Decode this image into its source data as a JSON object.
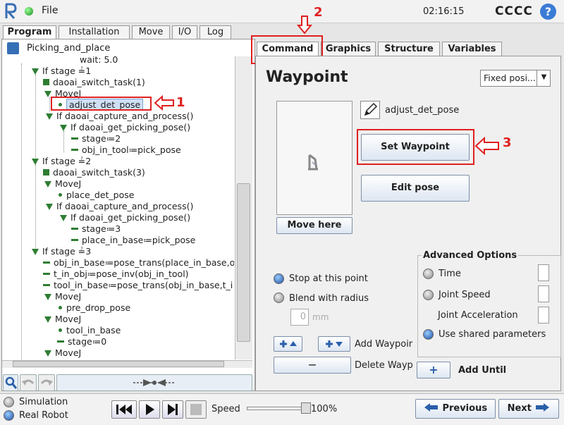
{
  "topbar": {
    "file_menu": "File",
    "clock": "02:16:15",
    "robot_name": "CCCC",
    "help": "?"
  },
  "main_tabs": [
    "Program",
    "Installation",
    "Move",
    "I/O",
    "Log"
  ],
  "program_name": "Picking_and_place",
  "tree": [
    "wait: 5.0",
    "If stage ≟1",
    "daoai_switch_task(1)",
    "MoveJ",
    "adjust_det_pose",
    "If daoai_capture_and_process()",
    "If daoai_get_picking_pose()",
    "stage≔2",
    "obj_in_tool≔pick_pose",
    "If stage ≟2",
    "daoai_switch_task(3)",
    "MoveJ",
    "place_det_pose",
    "If daoai_capture_and_process()",
    "If daoai_get_picking_pose()",
    "stage≔3",
    "place_in_base≔pick_pose",
    "If stage ≟3",
    "obj_in_base≔pose_trans(place_in_base,o",
    "t_in_obj≔pose_inv(obj_in_tool)",
    "tool_in_base≔pose_trans(obj_in_base,t_i",
    "MoveJ",
    "pre_drop_pose",
    "MoveJ",
    "tool_in_base",
    "stage≔0",
    "MoveJ"
  ],
  "right_tabs": [
    "Command",
    "Graphics",
    "Structure",
    "Variables"
  ],
  "waypoint": {
    "title": "Waypoint",
    "mode": "Fixed posi...",
    "name": "adjust_det_pose",
    "set_waypoint": "Set Waypoint",
    "edit_pose": "Edit pose",
    "move_here": "Move here",
    "stop_at_point": "Stop at this point",
    "blend_radius": "Blend with radius",
    "blend_value": "0",
    "blend_unit": "mm",
    "add_waypoint": "Add Waypoir",
    "delete_waypoint": "Delete Wayp",
    "add_until": "Add Until",
    "add_symbol": "+",
    "delete_symbol": "—"
  },
  "advanced": {
    "title": "Advanced Options",
    "time": "Time",
    "joint_speed": "Joint Speed",
    "joint_accel": "Joint Acceleration",
    "shared": "Use shared parameters"
  },
  "annotations": [
    "1",
    "2",
    "3"
  ],
  "bottom": {
    "simulation": "Simulation",
    "real_robot": "Real Robot",
    "speed_label": "Speed",
    "speed_value": "100%",
    "speed_fraction": 1.0,
    "previous": "Previous",
    "next": "Next"
  }
}
